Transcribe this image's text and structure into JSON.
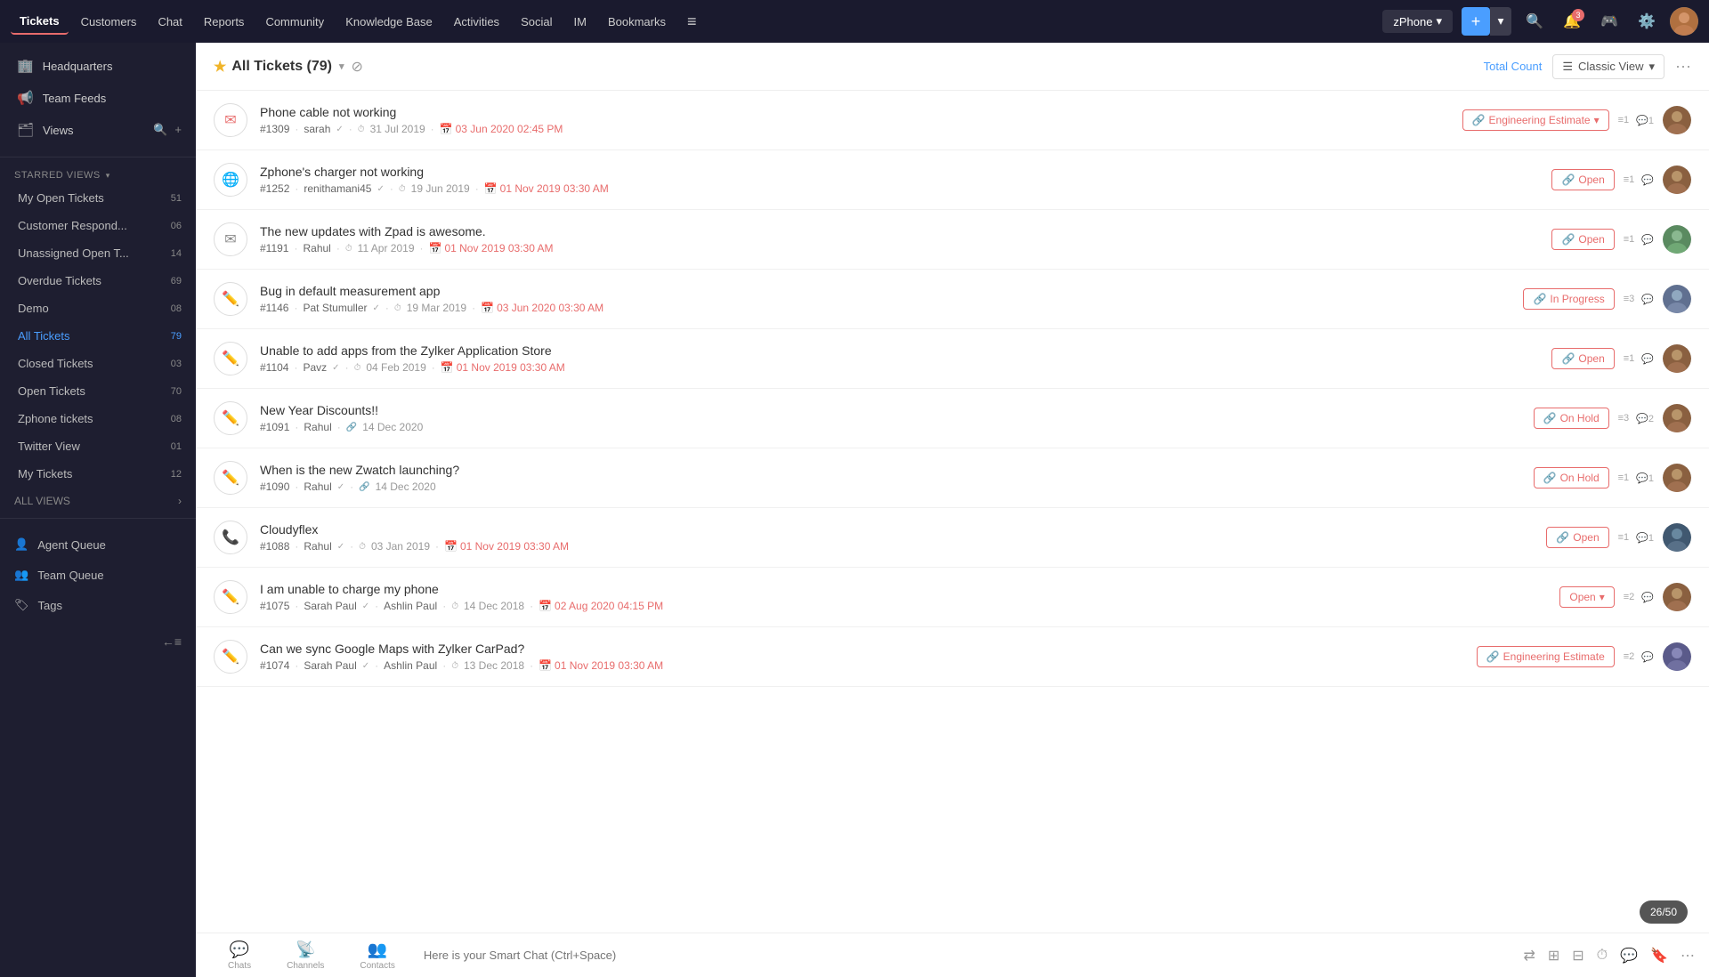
{
  "topNav": {
    "items": [
      {
        "label": "Tickets",
        "active": true
      },
      {
        "label": "Customers",
        "active": false
      },
      {
        "label": "Chat",
        "active": false
      },
      {
        "label": "Reports",
        "active": false
      },
      {
        "label": "Community",
        "active": false
      },
      {
        "label": "Knowledge Base",
        "active": false
      },
      {
        "label": "Activities",
        "active": false
      },
      {
        "label": "Social",
        "active": false
      },
      {
        "label": "IM",
        "active": false
      },
      {
        "label": "Bookmarks",
        "active": false
      }
    ],
    "zphone": "zPhone",
    "badge": "3",
    "menuIcon": "≡"
  },
  "sidebar": {
    "headquarters": "Headquarters",
    "teamFeeds": "Team Feeds",
    "views": "Views",
    "starredViews": "STARRED VIEWS",
    "viewItems": [
      {
        "label": "My Open Tickets",
        "count": "51"
      },
      {
        "label": "Customer Respond...",
        "count": "06"
      },
      {
        "label": "Unassigned Open T...",
        "count": "14"
      },
      {
        "label": "Overdue Tickets",
        "count": "69"
      },
      {
        "label": "Demo",
        "count": "08"
      },
      {
        "label": "All Tickets",
        "count": "79",
        "active": true
      },
      {
        "label": "Closed Tickets",
        "count": "03"
      },
      {
        "label": "Open Tickets",
        "count": "70"
      },
      {
        "label": "Zphone tickets",
        "count": "08"
      },
      {
        "label": "Twitter View",
        "count": "01"
      },
      {
        "label": "My Tickets",
        "count": "12"
      }
    ],
    "allViews": "ALL VIEWS",
    "agentQueue": "Agent Queue",
    "teamQueue": "Team Queue",
    "tags": "Tags",
    "collapseLabel": "←≡"
  },
  "header": {
    "star": "★",
    "title": "All Tickets (79)",
    "totalCount": "Total Count",
    "classicView": "Classic View",
    "moreIcon": "···"
  },
  "tickets": [
    {
      "id": "#1309",
      "title": "Phone cable not working",
      "agent": "sarah",
      "dateCreated": "31 Jul 2019",
      "dueDateLabel": "03 Jun 2020 02:45 PM",
      "status": "Engineering Estimate",
      "statusClass": "status-engineering",
      "hasDropdown": true,
      "replyCount": "1",
      "commentCount": "1",
      "iconType": "email-x"
    },
    {
      "id": "#1252",
      "title": "Zphone's charger not working",
      "agent": "renithamani45",
      "dateCreated": "19 Jun 2019",
      "dueDateLabel": "01 Nov 2019 03:30 AM",
      "status": "Open",
      "statusClass": "status-open",
      "hasDropdown": false,
      "replyCount": "1",
      "commentCount": "",
      "iconType": "globe"
    },
    {
      "id": "#1191",
      "title": "The new updates with Zpad is awesome.",
      "agent": "Rahul",
      "dateCreated": "11 Apr 2019",
      "dueDateLabel": "01 Nov 2019 03:30 AM",
      "status": "Open",
      "statusClass": "status-open",
      "hasDropdown": false,
      "replyCount": "1",
      "commentCount": "",
      "iconType": "email-x"
    },
    {
      "id": "#1146",
      "title": "Bug in default measurement app",
      "agent": "Pat Stumuller",
      "dateCreated": "19 Mar 2019",
      "dueDateLabel": "03 Jun 2020 03:30 AM",
      "status": "In Progress",
      "statusClass": "status-in-progress",
      "hasDropdown": false,
      "replyCount": "3",
      "commentCount": "",
      "iconType": "edit"
    },
    {
      "id": "#1104",
      "title": "Unable to add apps from the Zylker Application Store",
      "agent": "Pavz",
      "dateCreated": "04 Feb 2019",
      "dueDateLabel": "01 Nov 2019 03:30 AM",
      "status": "Open",
      "statusClass": "status-open",
      "hasDropdown": false,
      "replyCount": "1",
      "commentCount": "",
      "iconType": "edit"
    },
    {
      "id": "#1091",
      "title": "New Year Discounts!!",
      "agent": "Rahul",
      "dateCreated": "14 Dec 2020",
      "dueDateLabel": "",
      "status": "On Hold",
      "statusClass": "status-on-hold",
      "hasDropdown": false,
      "replyCount": "3",
      "commentCount": "2",
      "iconType": "edit"
    },
    {
      "id": "#1090",
      "title": "When is the new Zwatch launching?",
      "agent": "Rahul",
      "dateCreated": "14 Dec 2020",
      "dueDateLabel": "",
      "status": "On Hold",
      "statusClass": "status-on-hold",
      "hasDropdown": false,
      "replyCount": "1",
      "commentCount": "1",
      "iconType": "edit"
    },
    {
      "id": "#1088",
      "title": "Cloudyflex",
      "agent": "Rahul",
      "dateCreated": "03 Jan 2019",
      "dueDateLabel": "01 Nov 2019 03:30 AM",
      "status": "Open",
      "statusClass": "status-open",
      "hasDropdown": false,
      "replyCount": "1",
      "commentCount": "1",
      "iconType": "phone"
    },
    {
      "id": "#1075",
      "title": "I am unable to charge my phone",
      "agent": "Sarah Paul",
      "agent2": "Ashlin Paul",
      "dateCreated": "14 Dec 2018",
      "dueDateLabel": "02 Aug 2020 04:15 PM",
      "status": "Open",
      "statusClass": "status-open",
      "hasDropdown": false,
      "replyCount": "2",
      "commentCount": "",
      "iconType": "edit"
    },
    {
      "id": "#1074",
      "title": "Can we sync Google Maps with Zylker CarPad?",
      "agent": "Sarah Paul",
      "agent2": "Ashlin Paul",
      "dateCreated": "13 Dec 2018",
      "dueDateLabel": "01 Nov 2019 03:30 AM",
      "status": "Engineering Estimate",
      "statusClass": "status-engineering",
      "hasDropdown": false,
      "replyCount": "2",
      "commentCount": "",
      "iconType": "edit"
    }
  ],
  "bottomBar": {
    "placeholder": "Here is your Smart Chat (Ctrl+Space)",
    "navItems": [
      {
        "label": "Chats",
        "icon": "💬"
      },
      {
        "label": "Channels",
        "icon": "📡"
      },
      {
        "label": "Contacts",
        "icon": "👥"
      }
    ]
  },
  "pageCount": "26/50"
}
